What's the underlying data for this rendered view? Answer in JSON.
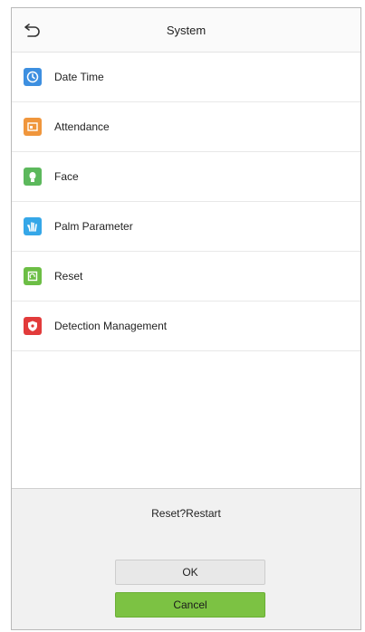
{
  "header": {
    "title": "System",
    "back_icon": "back-arrow-icon"
  },
  "menu": [
    {
      "label": "Date Time",
      "icon": "clock-icon",
      "color": "#3d8fe0"
    },
    {
      "label": "Attendance",
      "icon": "attendance-icon",
      "color": "#f0963c"
    },
    {
      "label": "Face",
      "icon": "face-icon",
      "color": "#5cb85c"
    },
    {
      "label": "Palm Parameter",
      "icon": "palm-icon",
      "color": "#35a7e8"
    },
    {
      "label": "Reset",
      "icon": "reset-icon",
      "color": "#6cbe45"
    },
    {
      "label": "Detection Management",
      "icon": "shield-icon",
      "color": "#e23b3b"
    }
  ],
  "dialog": {
    "message": "Reset?Restart",
    "ok_label": "OK",
    "cancel_label": "Cancel"
  },
  "colors": {
    "accent_green": "#7cc243"
  }
}
